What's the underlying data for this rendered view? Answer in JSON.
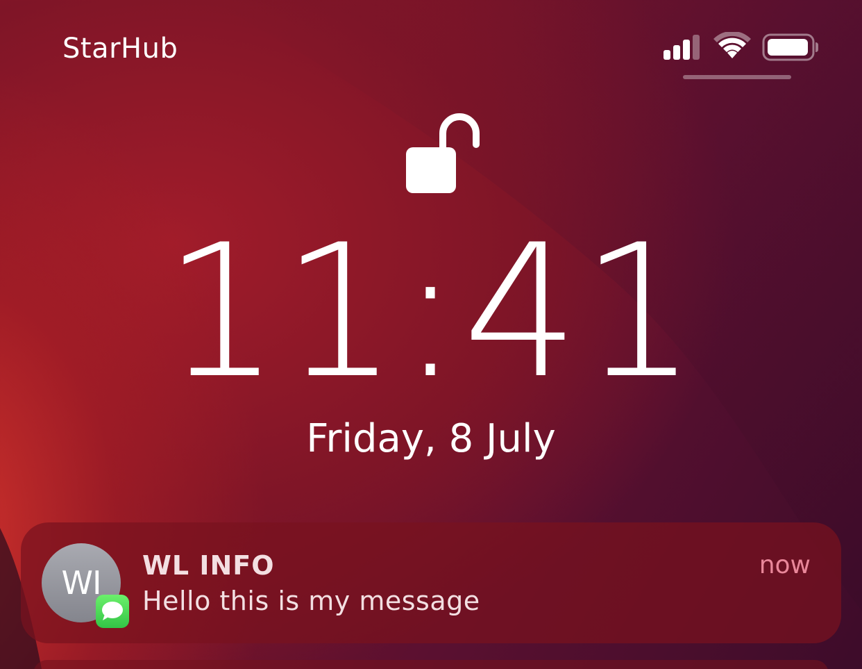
{
  "status_bar": {
    "carrier": "StarHub",
    "signal_icon": "cellular-signal-icon",
    "signal_bars_active": 3,
    "signal_bars_total": 4,
    "wifi_icon": "wifi-icon",
    "battery_icon": "battery-icon",
    "battery_level": 0.9
  },
  "lock": {
    "icon": "unlocked-padlock-icon"
  },
  "clock": {
    "time": "11:41"
  },
  "date": {
    "text": "Friday, 8 July"
  },
  "notification": {
    "avatar_initials": "WI",
    "app_icon": "messages-icon",
    "sender": "WL INFO",
    "message": "Hello this is my message",
    "time": "now"
  },
  "colors": {
    "accent_time": "#e9879a",
    "messages_green": "#33c446"
  }
}
